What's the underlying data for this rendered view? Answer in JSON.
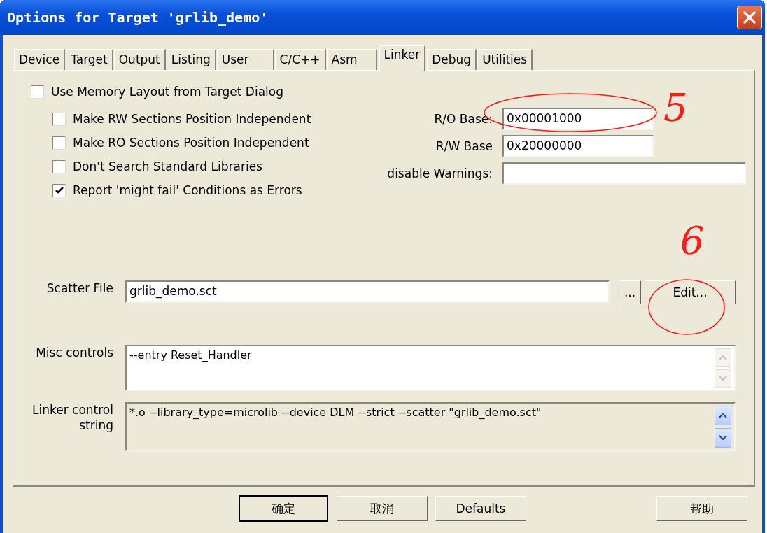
{
  "window": {
    "title": "Options for Target 'grlib_demo'"
  },
  "tabs": [
    {
      "label": "Device",
      "selected": false
    },
    {
      "label": "Target",
      "selected": false
    },
    {
      "label": "Output",
      "selected": false
    },
    {
      "label": "Listing",
      "selected": false
    },
    {
      "label": "User",
      "selected": false
    },
    {
      "label": "C/C++",
      "selected": false
    },
    {
      "label": "Asm",
      "selected": false
    },
    {
      "label": "Linker",
      "selected": true
    },
    {
      "label": "Debug",
      "selected": false
    },
    {
      "label": "Utilities",
      "selected": false
    }
  ],
  "use_memory_layout": {
    "label": "Use Memory Layout from Target Dialog",
    "checked": false
  },
  "options": [
    {
      "label": "Make RW Sections Position Independent",
      "checked": false
    },
    {
      "label": "Make RO Sections Position Independent",
      "checked": false
    },
    {
      "label": "Don't Search Standard Libraries",
      "checked": false
    },
    {
      "label": "Report 'might fail' Conditions as Errors",
      "checked": true
    }
  ],
  "ro_base": {
    "label": "R/O Base:",
    "value": "0x00001000"
  },
  "rw_base": {
    "label": "R/W Base",
    "value": "0x20000000"
  },
  "disable_warnings": {
    "label": "disable Warnings:"
  },
  "scatter_file": {
    "label": "Scatter File",
    "value": "grlib_demo.sct",
    "browse": "...",
    "edit": "Edit..."
  },
  "misc_controls": {
    "label": "Misc controls",
    "value": "--entry Reset_Handler"
  },
  "linker_control_string": {
    "label": "Linker control string",
    "value": "*.o --library_type=microlib --device DLM --strict --scatter \"grlib_demo.sct\""
  },
  "buttons": [
    {
      "label": "确定",
      "default": true
    },
    {
      "label": "取消",
      "default": false
    },
    {
      "label": "Defaults",
      "default": false
    },
    {
      "label": "帮助",
      "default": false
    }
  ],
  "annotations": [
    {
      "label": "5"
    },
    {
      "label": "6"
    }
  ]
}
